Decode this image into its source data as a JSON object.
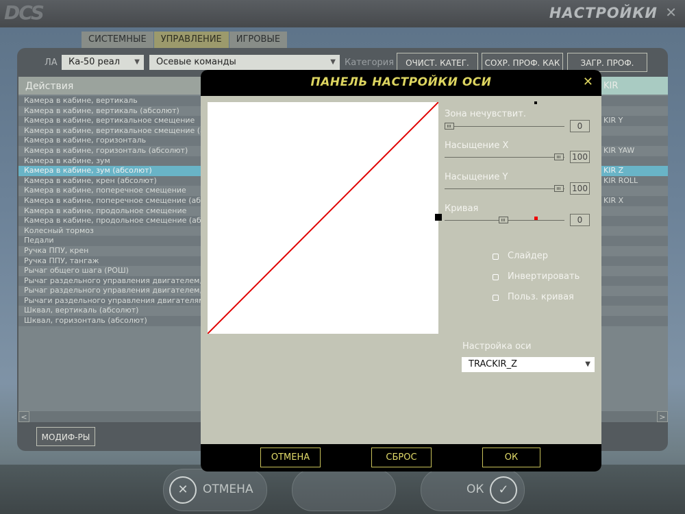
{
  "app": {
    "logo": "DCS",
    "title": "НАСТРОЙКИ",
    "close_glyph": "✕"
  },
  "tabs": [
    {
      "label": "СИСТЕМНЫЕ",
      "active": false
    },
    {
      "label": "УПРАВЛЕНИЕ",
      "active": true
    },
    {
      "label": "ИГРОВЫЕ",
      "active": false
    }
  ],
  "filters": {
    "la_label": "ЛА",
    "aircraft": "Ка-50 реал",
    "command_type": "Осевые команды",
    "category_label": "Категория"
  },
  "toolbar": {
    "clear_category": "ОЧИСТ. КАТЕГ.",
    "save_profile_as": "СОХР. ПРОФ. КАК",
    "load_profile": "ЗАГР. ПРОФ."
  },
  "list": {
    "header_actions": "Действия",
    "header_right_partial": "KIR",
    "actions": [
      "Камера в кабине, вертикаль",
      "Камера в кабине, вертикаль (абсолют)",
      "Камера в кабине, вертикальное смещение",
      "Камера в кабине, вертикальное смещение (абсолют)",
      "Камера в кабине, горизонталь",
      "Камера в кабине, горизонталь (абсолют)",
      "Камера в кабине, зум",
      "Камера в кабине, зум (абсолют)",
      "Камера в кабине, крен (абсолют)",
      "Камера в кабине, поперечное смещение",
      "Камера в кабине, поперечное смещение (абсолют)",
      "Камера в кабине, продольное смещение",
      "Камера в кабине, продольное смещение (абсолют)",
      "Колесный тормоз",
      "Педали",
      "Ручка ППУ, крен",
      "Ручка ППУ, тангаж",
      "Рычаг общего шага (РОШ)",
      "Рычаг раздельного управления двигателем, левый",
      "Рычаг раздельного управления двигателем, правый",
      "Рычаги раздельного управления двигателями",
      "Шквал, вертикаль (абсолют)",
      "Шквал, горизонталь (абсолют)"
    ],
    "selected_index": 7,
    "bindings": [
      "",
      "",
      "KIR Y",
      "",
      "",
      "KIR YAW",
      "",
      "KIR Z",
      "KIR ROLL",
      "",
      "KIR X",
      "",
      "",
      "",
      "",
      "",
      "",
      "",
      "",
      "",
      "",
      "",
      ""
    ],
    "scroll_left": "<",
    "scroll_right": ">"
  },
  "modifiers_button": "МОДИФ-РЫ",
  "bottom": {
    "cancel_label": "ОТМЕНА",
    "cancel_icon": "✕",
    "ok_label": "ОК",
    "ok_icon": "✓"
  },
  "modal": {
    "title": "ПАНЕЛЬ НАСТРОЙКИ ОСИ",
    "close_glyph": "✕",
    "deadzone_label": "Зона нечувствит.",
    "deadzone_value": "0",
    "saturation_x_label": "Насыщение X",
    "saturation_x_value": "100",
    "saturation_y_label": "Насыщение Y",
    "saturation_y_value": "100",
    "curve_label": "Кривая",
    "curve_value": "0",
    "slider_label": "Слайдер",
    "invert_label": "Инвертировать",
    "user_curve_label": "Польз. кривая",
    "axis_setting_label": "Настройка оси",
    "axis_selected": "TRACKIR_Z",
    "cancel_button": "ОТМЕНА",
    "reset_button": "СБРОС",
    "ok_button": "ОК",
    "curve_color": "#e00000"
  }
}
